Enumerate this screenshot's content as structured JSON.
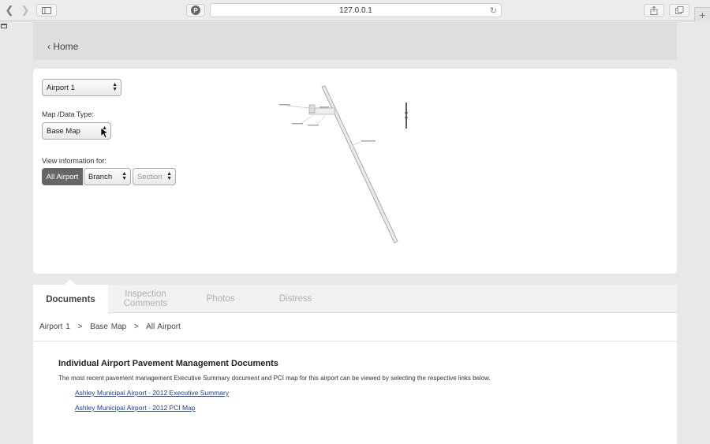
{
  "browser": {
    "url": "127.0.0.1",
    "icons": {
      "back": "chevron-left-icon",
      "forward": "chevron-right-icon",
      "sidebar": "sidebar-icon",
      "pinned_site": "pinterest-icon",
      "reload": "reload-icon",
      "share": "share-icon",
      "tabs": "tabs-icon",
      "new_tab": "plus-icon"
    }
  },
  "header": {
    "home_link": "‹ Home"
  },
  "map_panel": {
    "airport_select": {
      "value": "Airport 1"
    },
    "map_type_label": "Map /Data Type:",
    "map_type_select": {
      "value": "Base Map"
    },
    "view_label": "View information for:",
    "view_buttons": {
      "all_airport": "All Airport",
      "branch": "Branch",
      "section": "Section"
    }
  },
  "tabs": [
    {
      "label": "Documents",
      "active": true
    },
    {
      "label": "Inspection Comments",
      "active": false
    },
    {
      "label": "Photos",
      "active": false
    },
    {
      "label": "Distress",
      "active": false
    }
  ],
  "breadcrumb": {
    "items": [
      "Airport 1",
      "Base Map",
      "All Airport"
    ],
    "separator": ">"
  },
  "documents": {
    "title": "Individual Airport Pavement Management Documents",
    "description": "The most recent pavement management Executive Summary document and PCI map for this airport can be viewed by selecting the respective links below.",
    "links": [
      "Ashley Municipal Airport - 2012 Executive Summary",
      "Ashley Municipal Airport - 2012 PCI Map"
    ]
  },
  "colors": {
    "active_button": "#666666",
    "link": "#1a3d9e",
    "panel_bg": "#ffffff",
    "page_bg": "#e8e8e8"
  }
}
